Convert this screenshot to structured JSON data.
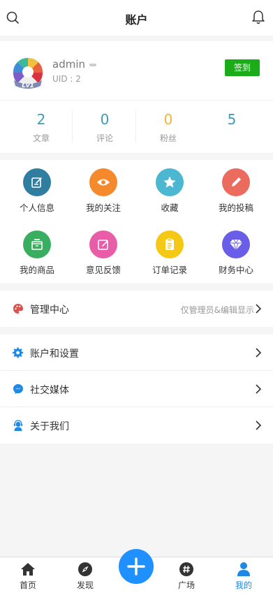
{
  "header": {
    "title": "账户",
    "search_icon": "search-icon",
    "bell_icon": "bell-icon"
  },
  "profile": {
    "username": "admin",
    "uid": "UID : 2",
    "level": "Lv1",
    "signin_label": "签到",
    "signin_color": "#1aad19"
  },
  "stats": [
    {
      "value": "2",
      "label": "文章"
    },
    {
      "value": "0",
      "label": "评论"
    },
    {
      "value": "0",
      "label": "粉丝"
    },
    {
      "value": "5",
      "label": ""
    }
  ],
  "grid": [
    {
      "label": "个人信息",
      "icon": "edit-icon",
      "color": "#2f7ea0"
    },
    {
      "label": "我的关注",
      "icon": "eye-icon",
      "color": "#f58a2c"
    },
    {
      "label": "收藏",
      "icon": "star-icon",
      "color": "#4bb7d0"
    },
    {
      "label": "我的投稿",
      "icon": "pencil-icon",
      "color": "#ec6b5f"
    },
    {
      "label": "我的商品",
      "icon": "box-icon",
      "color": "#3aae60"
    },
    {
      "label": "意见反馈",
      "icon": "feedback-icon",
      "color": "#e85ca8"
    },
    {
      "label": "订单记录",
      "icon": "clipboard-icon",
      "color": "#f5c816"
    },
    {
      "label": "财务中心",
      "icon": "diamond-icon",
      "color": "#6a5ee8"
    }
  ],
  "menu": {
    "admin": {
      "label": "管理中心",
      "hint": "仅管理员&编辑显示",
      "icon": "palette-icon"
    },
    "settings": {
      "label": "账户和设置",
      "icon": "gear-icon"
    },
    "social": {
      "label": "社交媒体",
      "icon": "messenger-icon"
    },
    "about": {
      "label": "关于我们",
      "icon": "support-icon"
    }
  },
  "tabbar": {
    "home": "首页",
    "discover": "发现",
    "plaza": "广场",
    "mine": "我的",
    "active": "mine",
    "active_color": "#1e88e5"
  }
}
